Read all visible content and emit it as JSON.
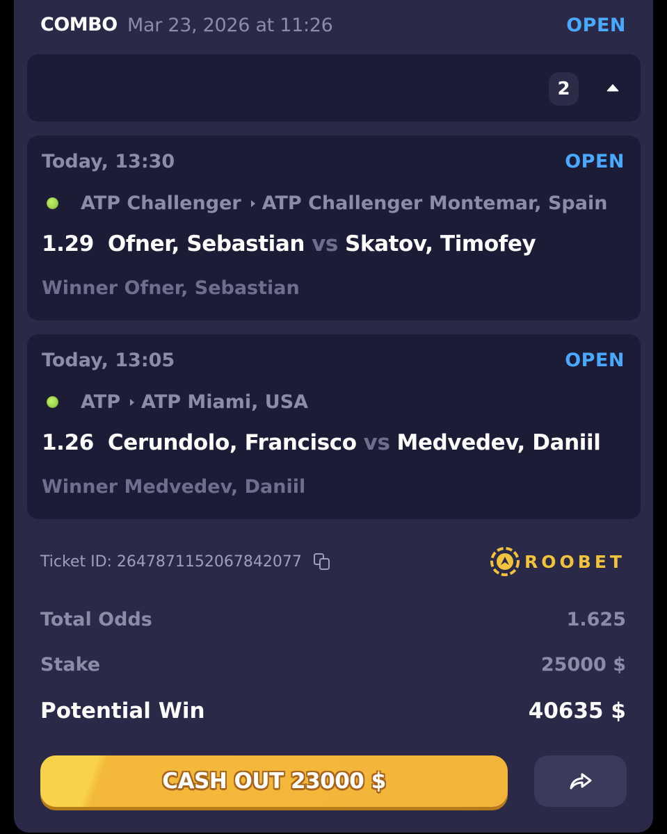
{
  "header": {
    "bet_type": "COMBO",
    "date": "Mar 23, 2026 at 11:26",
    "status": "OPEN"
  },
  "selections_bar": {
    "count": "2"
  },
  "legs": [
    {
      "time": "Today, 13:30",
      "status": "OPEN",
      "sport_icon": "tennis-ball-icon",
      "category": "ATP Challenger",
      "tournament": "ATP Challenger Montemar, Spain",
      "odds": "1.29",
      "home": "Ofner, Sebastian",
      "vs": "vs",
      "away": "Skatov, Timofey",
      "selection": "Winner Ofner, Sebastian"
    },
    {
      "time": "Today, 13:05",
      "status": "OPEN",
      "sport_icon": "tennis-ball-icon",
      "category": "ATP",
      "tournament": "ATP Miami, USA",
      "odds": "1.26",
      "home": "Cerundolo, Francisco",
      "vs": "vs",
      "away": "Medvedev, Daniil",
      "selection": "Winner Medvedev, Daniil"
    }
  ],
  "ticket": {
    "label": "Ticket ID: 2647871152067842077",
    "brand": "ROOBET"
  },
  "summary": {
    "total_odds_label": "Total Odds",
    "total_odds_value": "1.625",
    "stake_label": "Stake",
    "stake_value": "25000 $",
    "potential_win_label": "Potential Win",
    "potential_win_value": "40635 $"
  },
  "actions": {
    "cashout_label": "CASH OUT 23000 $"
  },
  "colors": {
    "card_bg": "#2a2947",
    "panel_bg": "#1d1c36",
    "status_blue": "#49a8ff",
    "muted_text": "#8d8ca6",
    "cashout_yellow": "#f2b53a",
    "brand_gold": "#f1c23c"
  }
}
